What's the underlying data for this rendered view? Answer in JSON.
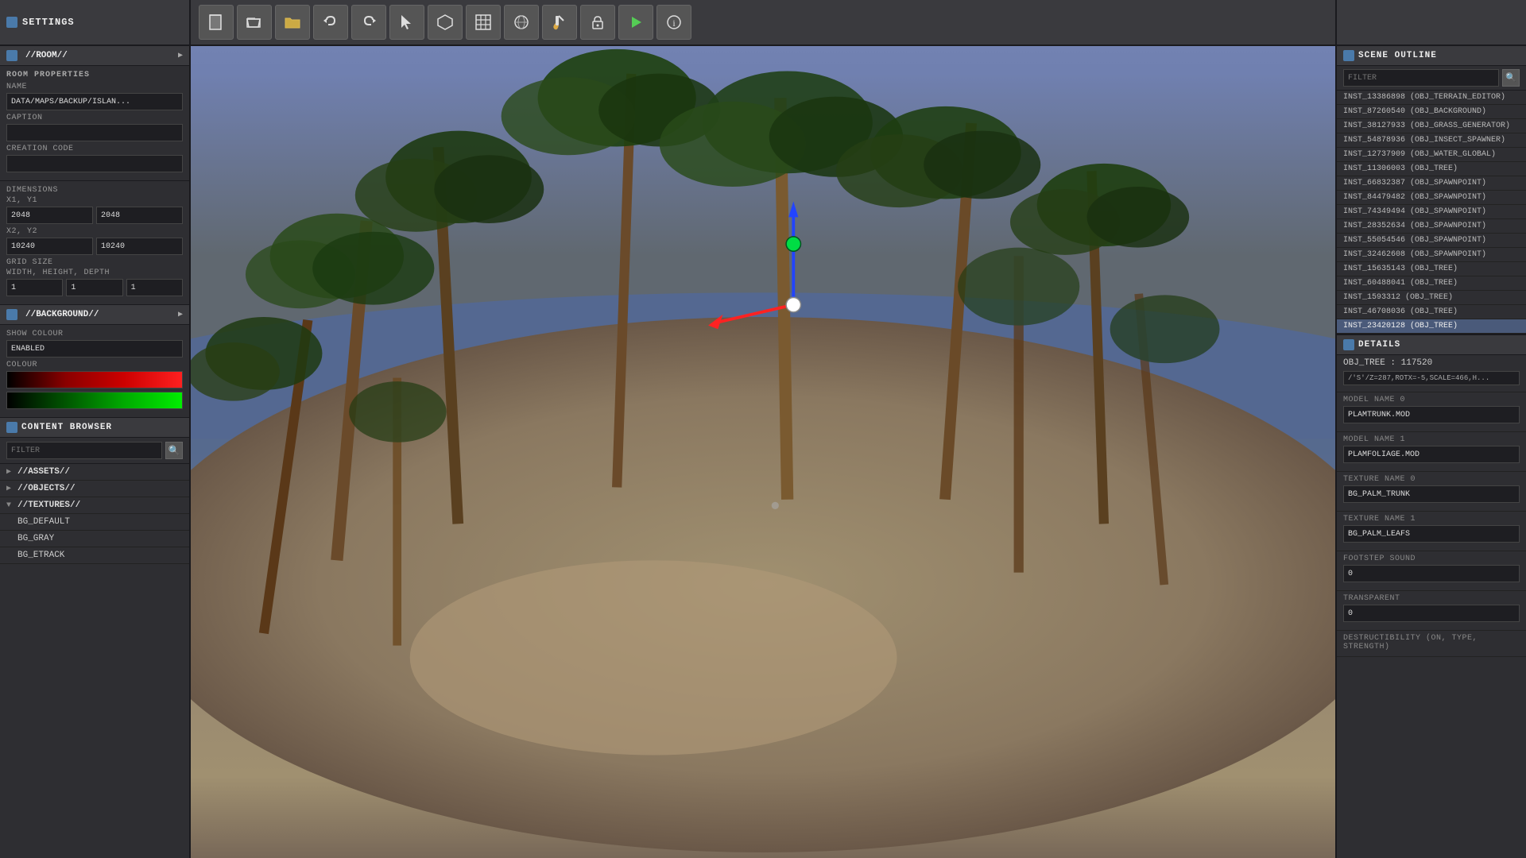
{
  "top": {
    "settings_label": "SETTINGS",
    "toolbar": {
      "buttons": [
        {
          "icon": "📄",
          "label": "new",
          "active": false
        },
        {
          "icon": "🗂",
          "label": "open",
          "active": false
        },
        {
          "icon": "📁",
          "label": "folder",
          "active": false
        },
        {
          "icon": "↩",
          "label": "undo",
          "active": false
        },
        {
          "icon": "↪",
          "label": "redo",
          "active": false
        },
        {
          "icon": "◀",
          "label": "back",
          "active": false
        },
        {
          "icon": "⬡",
          "label": "object",
          "active": false
        },
        {
          "icon": "≋",
          "label": "grid",
          "active": false
        },
        {
          "icon": "◎",
          "label": "sphere",
          "active": false
        },
        {
          "icon": "🎨",
          "label": "paint",
          "active": false
        },
        {
          "icon": "🔒",
          "label": "lock",
          "active": false
        },
        {
          "icon": "▶",
          "label": "play",
          "active": false
        },
        {
          "icon": "ℹ",
          "label": "info",
          "active": false
        }
      ]
    }
  },
  "left_panel": {
    "room_section": "//ROOM//",
    "room_properties": "ROOM PROPERTIES",
    "name_label": "NAME",
    "name_value": "DATA/MAPS/BACKUP/ISLAN...",
    "caption_label": "CAPTION",
    "caption_value": "",
    "creation_code_label": "CREATION CODE",
    "creation_code_value": "",
    "dimensions_label": "DIMENSIONS",
    "x1y1_label": "X1, Y1",
    "x1_value": "2048",
    "y1_value": "2048",
    "x2y2_label": "X2, Y2",
    "x2_value": "10240",
    "y2_value": "10240",
    "grid_size_label": "GRID SIZE",
    "width_height_depth_label": "WIDTH, HEIGHT, DEPTH",
    "width_value": "1",
    "height_value": "1",
    "depth_value": "1",
    "background_section": "//BACKGROUND//",
    "show_colour_label": "SHOW COLOUR",
    "show_colour_value": "ENABLED",
    "colour_label": "COLOUR"
  },
  "content_browser": {
    "title": "CONTENT BROWSER",
    "filter_placeholder": "FILTER",
    "items": [
      {
        "label": "//ASSETS//",
        "has_children": true
      },
      {
        "label": "//OBJECTS//",
        "has_children": true
      },
      {
        "label": "//TEXTURES//",
        "has_children": true,
        "expanded": true
      },
      {
        "label": "BG_DEFAULT",
        "has_children": false
      },
      {
        "label": "BG_GRAY",
        "has_children": false
      },
      {
        "label": "BG_ETRACK",
        "has_children": false
      }
    ]
  },
  "scene_outline": {
    "title": "SCENE OUTLINE",
    "filter_placeholder": "FILTER",
    "items": [
      {
        "id": "INST_13386898",
        "obj": "OBJ_TERRAIN_EDITOR"
      },
      {
        "id": "INST_87260540",
        "obj": "OBJ_BACKGROUND"
      },
      {
        "id": "INST_38127933",
        "obj": "OBJ_GRASS_GENERATOR"
      },
      {
        "id": "INST_54878936",
        "obj": "OBJ_INSECT_SPAWNER"
      },
      {
        "id": "INST_12737909",
        "obj": "OBJ_WATER_GLOBAL"
      },
      {
        "id": "INST_11306003",
        "obj": "OBJ_TREE"
      },
      {
        "id": "INST_66832387",
        "obj": "OBJ_SPAWNPOINT"
      },
      {
        "id": "INST_84479482",
        "obj": "OBJ_SPAWNPOINT"
      },
      {
        "id": "INST_74349494",
        "obj": "OBJ_SPAWNPOINT"
      },
      {
        "id": "INST_28352634",
        "obj": "OBJ_SPAWNPOINT"
      },
      {
        "id": "INST_55054546",
        "obj": "OBJ_SPAWNPOINT"
      },
      {
        "id": "INST_32462608",
        "obj": "OBJ_SPAWNPOINT"
      },
      {
        "id": "INST_15635143",
        "obj": "OBJ_TREE"
      },
      {
        "id": "INST_60488041",
        "obj": "OBJ_TREE"
      },
      {
        "id": "INST_1593312",
        "obj": "OBJ_TREE"
      },
      {
        "id": "INST_46708036",
        "obj": "OBJ_TREE"
      },
      {
        "id": "INST_23420128",
        "obj": "OBJ_TREE",
        "selected": true
      }
    ]
  },
  "details": {
    "title": "DETAILS",
    "obj_name": "OBJ_TREE : 117520",
    "script_value": "/'S'/Z=287,ROTX=-5,SCALE=466,H...",
    "model_name_0_label": "MODEL NAME  0",
    "model_name_0_value": "PLAMTRUNK.MOD",
    "model_name_1_label": "MODEL NAME  1",
    "model_name_1_value": "PLAMFOLIAGE.MOD",
    "texture_name_0_label": "TEXTURE NAME  0",
    "texture_name_0_value": "BG_PALM_TRUNK",
    "texture_name_1_label": "TEXTURE NAME  1",
    "texture_name_1_value": "BG_PALM_LEAFS",
    "footstep_sound_label": "FOOTSTEP SOUND",
    "footstep_sound_value": "0",
    "transparent_label": "TRANSPARENT",
    "transparent_value": "0",
    "destructibility_label": "DESTRUCTIBILITY (ON, TYPE, STRENGTH)"
  },
  "colors": {
    "accent_blue": "#4a7aaa",
    "panel_bg": "#2e2e32",
    "header_bg": "#3a3a3e",
    "input_bg": "#1e1e22",
    "selected_bg": "#4a5a7a"
  }
}
